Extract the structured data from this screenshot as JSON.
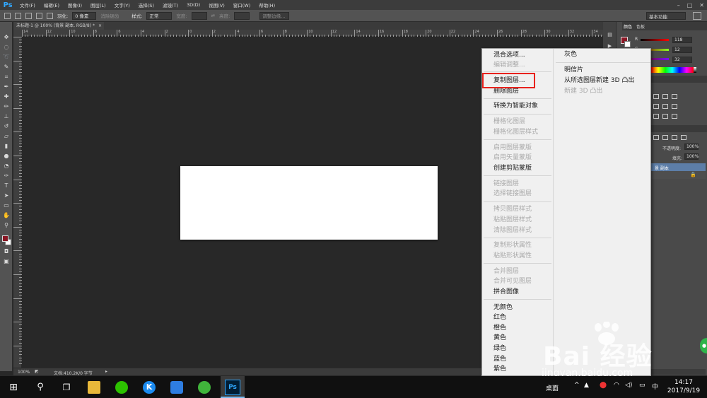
{
  "app": {
    "logo": "Ps",
    "menu": [
      "文件(F)",
      "编辑(E)",
      "图像(I)",
      "图层(L)",
      "文字(Y)",
      "选择(S)",
      "滤镜(T)",
      "3D(D)",
      "视图(V)",
      "窗口(W)",
      "帮助(H)"
    ],
    "window_controls": [
      "–",
      "□",
      "✕"
    ]
  },
  "options_bar": {
    "feather_label": "羽化:",
    "feather_value": "0 像素",
    "antialias_label": "消除锯齿",
    "style_label": "样式:",
    "style_value": "正常",
    "width_label": "宽度:",
    "height_label": "高度:",
    "refine_edge_label": "调整边缘...",
    "workspace": "基本功能"
  },
  "document": {
    "tab_title": "未标题-1 @ 100% (背景 副本, RGB/8) *",
    "tab_close": "×",
    "ruler_numbers": [
      "14",
      "12",
      "10",
      "8",
      "6",
      "4",
      "2",
      "0",
      "2",
      "4",
      "6",
      "8",
      "10",
      "12",
      "14",
      "16",
      "18",
      "20",
      "22",
      "24",
      "26",
      "28",
      "30",
      "32",
      "34",
      "36"
    ],
    "canvas_color": "#ffffff"
  },
  "status_bar": {
    "zoom": "100%",
    "doc_info": "文档:410.2K/0 字节"
  },
  "panels": {
    "color_tabs": [
      "颜色",
      "色板"
    ],
    "rgb_values": [
      "118",
      "12",
      "32"
    ],
    "r_label": "R",
    "g_label": "G",
    "b_label": "B",
    "opacity_label": "不透明度:",
    "opacity_value": "100%",
    "fill_label": "填充:",
    "fill_value": "100%",
    "layer_name": "景 副本",
    "foreground_color": "#8a1624"
  },
  "context_menu": {
    "left_items": [
      {
        "label": "混合选项...",
        "enabled": true
      },
      {
        "label": "编辑调整...",
        "enabled": false
      },
      {
        "label": "复制图层...",
        "enabled": true
      },
      {
        "label": "删除图层",
        "enabled": true
      },
      {
        "label": "转换为智能对象",
        "enabled": true
      },
      {
        "label": "栅格化图层",
        "enabled": false
      },
      {
        "label": "栅格化图层样式",
        "enabled": false
      },
      {
        "label": "启用图层蒙版",
        "enabled": false
      },
      {
        "label": "启用矢量蒙版",
        "enabled": false
      },
      {
        "label": "创建剪贴蒙版",
        "enabled": true
      },
      {
        "label": "链接图层",
        "enabled": false
      },
      {
        "label": "选择链接图层",
        "enabled": false
      },
      {
        "label": "拷贝图层样式",
        "enabled": false
      },
      {
        "label": "粘贴图层样式",
        "enabled": false
      },
      {
        "label": "清除图层样式",
        "enabled": false
      },
      {
        "label": "复制形状属性",
        "enabled": false
      },
      {
        "label": "粘贴形状属性",
        "enabled": false
      },
      {
        "label": "合并图层",
        "enabled": false
      },
      {
        "label": "合并可见图层",
        "enabled": false
      },
      {
        "label": "拼合图像",
        "enabled": true
      },
      {
        "label": "无颜色",
        "enabled": true
      },
      {
        "label": "红色",
        "enabled": true
      },
      {
        "label": "橙色",
        "enabled": true
      },
      {
        "label": "黄色",
        "enabled": true
      },
      {
        "label": "绿色",
        "enabled": true
      },
      {
        "label": "蓝色",
        "enabled": true
      },
      {
        "label": "紫色",
        "enabled": true
      }
    ],
    "right_items": [
      {
        "label": "灰色",
        "enabled": true
      },
      {
        "label": "明信片",
        "enabled": true
      },
      {
        "label": "从所选图层新建 3D 凸出",
        "enabled": true
      },
      {
        "label": "新建 3D 凸出",
        "enabled": false
      }
    ],
    "highlighted_item": "复制图层...",
    "highlight_color": "#e8221d"
  },
  "watermark": {
    "text": "Bai 经验",
    "url": "jingyan.baidu.com"
  },
  "taskbar": {
    "desktop_label": "桌面",
    "ime": "中",
    "time": "14:17",
    "date": "2017/9/19",
    "kugou_letter": "K",
    "ps_label": "Ps"
  }
}
